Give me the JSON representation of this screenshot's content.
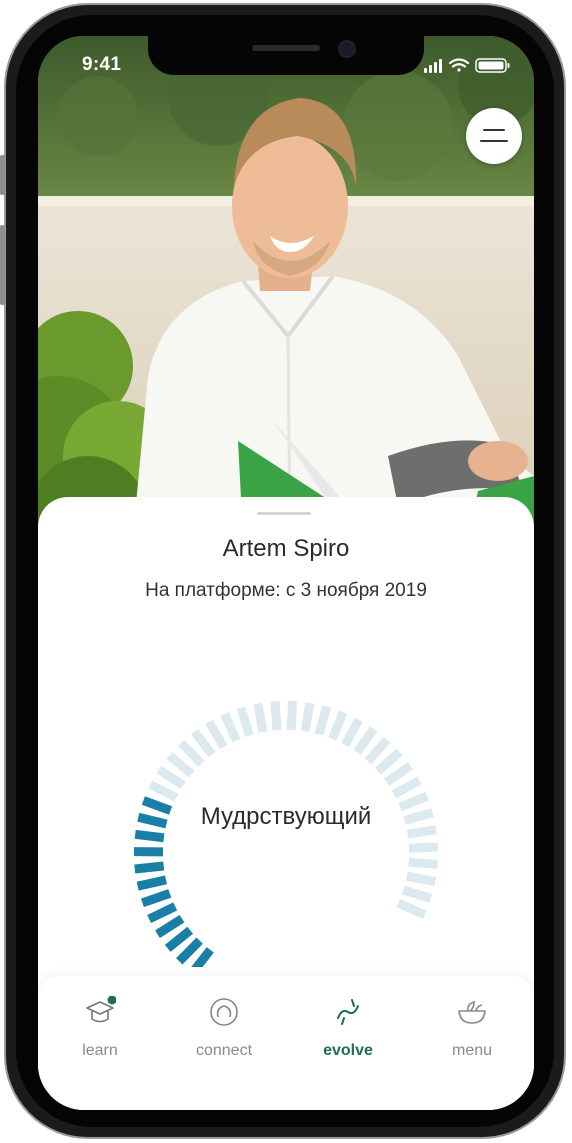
{
  "status_bar": {
    "time": "9:41"
  },
  "profile": {
    "name": "Artem Spiro",
    "member_since": "На платформе: с 3 ноября 2019"
  },
  "level": {
    "label": "Мудрствующий",
    "progress_segments": 12,
    "total_segments": 40,
    "active_color": "#1a7fa6",
    "inactive_color": "#dceaf0"
  },
  "tabs": [
    {
      "id": "learn",
      "label": "learn",
      "icon": "graduation-cap-icon",
      "badge": true,
      "active": false
    },
    {
      "id": "connect",
      "label": "connect",
      "icon": "connect-ring-icon",
      "active": false
    },
    {
      "id": "evolve",
      "label": "evolve",
      "icon": "evolve-wave-icon",
      "active": true
    },
    {
      "id": "menu",
      "label": "menu",
      "icon": "bowl-icon",
      "active": false
    }
  ],
  "colors": {
    "accent": "#1e6e57",
    "badge": "#1e6e57"
  }
}
